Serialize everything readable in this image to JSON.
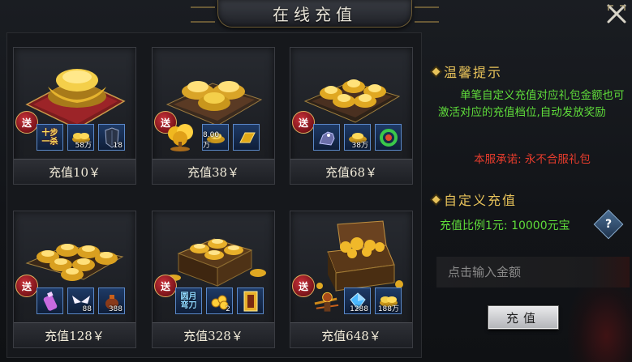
{
  "title": "在线充值",
  "products": [
    {
      "price": "充值10￥",
      "badge": "送",
      "items": [
        {
          "type": "text",
          "text": "十步一杀",
          "icon": "skill-scroll-icon"
        },
        {
          "type": "icon",
          "icon": "gold-ingot-pile-icon",
          "qty": "58万"
        },
        {
          "type": "icon",
          "icon": "armor-icon",
          "qty": "18"
        }
      ]
    },
    {
      "price": "充值38￥",
      "badge": "送",
      "items": [
        {
          "type": "bigicon",
          "icon": "gold-tree-icon"
        },
        {
          "type": "icon",
          "icon": "gold-ingot-pile-icon",
          "qty": "8.00万"
        },
        {
          "type": "icon",
          "icon": "gold-bar-icon",
          "qty": ""
        }
      ]
    },
    {
      "price": "充值68￥",
      "badge": "送",
      "items": [
        {
          "type": "icon",
          "icon": "mount-icon",
          "qty": ""
        },
        {
          "type": "icon",
          "icon": "gold-ingot-pile-icon",
          "qty": "38万"
        },
        {
          "type": "icon",
          "icon": "jade-ring-icon",
          "qty": ""
        }
      ]
    },
    {
      "price": "充值128￥",
      "badge": "送",
      "items": [
        {
          "type": "icon",
          "icon": "potion-icon",
          "qty": ""
        },
        {
          "type": "icon",
          "icon": "wings-icon",
          "qty": "88"
        },
        {
          "type": "icon",
          "icon": "pouch-icon",
          "qty": "388"
        }
      ]
    },
    {
      "price": "充值328￥",
      "badge": "送",
      "items": [
        {
          "type": "text",
          "text": "圆月弯刀",
          "icon": "weapon-scroll-icon",
          "white": true
        },
        {
          "type": "icon",
          "icon": "gold-coins-icon",
          "qty": "2"
        },
        {
          "type": "icon",
          "icon": "scroll-card-icon",
          "qty": ""
        }
      ]
    },
    {
      "price": "充值648￥",
      "badge": "送",
      "items": [
        {
          "type": "icon",
          "icon": "gear-bundle-icon",
          "qty": ""
        },
        {
          "type": "icon",
          "icon": "crystal-icon",
          "qty": "1288"
        },
        {
          "type": "icon",
          "icon": "gold-ingot-pile-icon",
          "qty": "188万"
        }
      ]
    }
  ],
  "tips": {
    "heading": "温馨提示",
    "body": "单笔自定义充值对应礼包金额也可激活对应的充值档位,自动发放奖励",
    "promise": "本服承诺: 永不合服礼包"
  },
  "custom": {
    "heading": "自定义充值",
    "ratio": "充值比例1元: 10000元宝",
    "placeholder": "点击输入金额",
    "button": "充值"
  },
  "colors": {
    "gold": "#e8c35a",
    "green": "#5fdc3a",
    "red": "#e83c2c",
    "slot_border": "#5a88c8"
  }
}
